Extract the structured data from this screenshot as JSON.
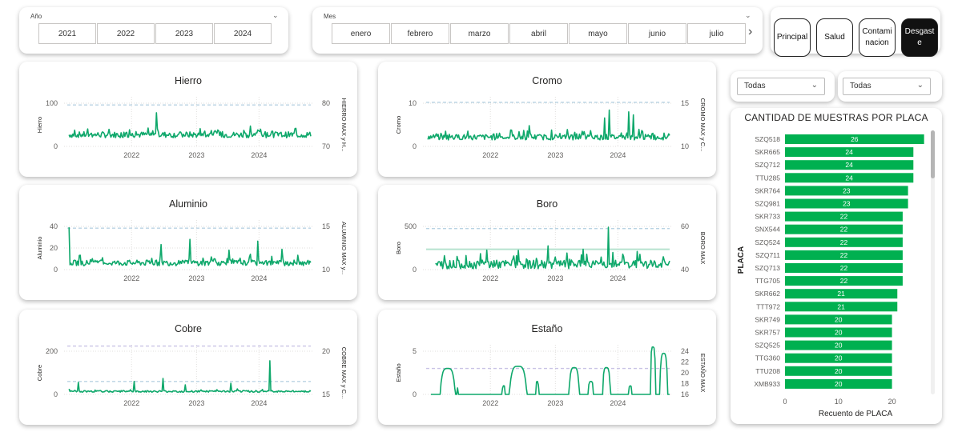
{
  "year_slicer": {
    "title": "Año",
    "items": [
      "2021",
      "2022",
      "2023",
      "2024"
    ]
  },
  "month_slicer": {
    "title": "Mes",
    "items": [
      "enero",
      "febrero",
      "marzo",
      "abril",
      "mayo",
      "junio",
      "julio"
    ]
  },
  "nav": {
    "buttons": [
      "Principal",
      "Salud",
      "Contami nacion",
      "Desgast e"
    ],
    "active": 3
  },
  "filters": {
    "left": "Todas",
    "right": "Todas"
  },
  "colors": {
    "line": "#0fa86b",
    "ref_dash": "#b9d3e3",
    "ref_dash_purple": "#c9c3e6",
    "ref_solid": "#b6e2cf",
    "bar": "#00b050"
  },
  "charts": [
    {
      "title": "Hierro",
      "ylabel": "Hierro",
      "y2label": "HIERRO MAX y H...",
      "yticks": [
        "100",
        "0"
      ],
      "y2ticks": [
        "80",
        "70"
      ],
      "xticks": [
        "2022",
        "2023",
        "2024"
      ]
    },
    {
      "title": "Cromo",
      "ylabel": "Cromo",
      "y2label": "CROMO MAX y C...",
      "yticks": [
        "10",
        "0"
      ],
      "y2ticks": [
        "15",
        "10"
      ],
      "xticks": [
        "2022",
        "2023",
        "2024"
      ]
    },
    {
      "title": "Aluminio",
      "ylabel": "Aluminio",
      "y2label": "ALUMINIO MAX y...",
      "yticks": [
        "40",
        "20",
        "0"
      ],
      "y2ticks": [
        "15",
        "10"
      ],
      "xticks": [
        "2022",
        "2023",
        "2024"
      ]
    },
    {
      "title": "Boro",
      "ylabel": "Boro",
      "y2label": "BORO MAX",
      "yticks": [
        "500",
        "0"
      ],
      "y2ticks": [
        "60",
        "40"
      ],
      "xticks": [
        "2022",
        "2023",
        "2024"
      ]
    },
    {
      "title": "Cobre",
      "ylabel": "Cobre",
      "y2label": "COBRE MAX y C...",
      "yticks": [
        "200",
        "0"
      ],
      "y2ticks": [
        "20",
        "15"
      ],
      "xticks": [
        "2022",
        "2023",
        "2024"
      ]
    },
    {
      "title": "Estaño",
      "ylabel": "Estaño",
      "y2label": "ESTAÑO MAX",
      "yticks": [
        "5",
        "0"
      ],
      "y2ticks": [
        "24",
        "22",
        "20",
        "18",
        "16"
      ],
      "xticks": [
        "2022",
        "2023",
        "2024"
      ]
    }
  ],
  "chart_data": [
    {
      "type": "bar",
      "title": "CANTIDAD DE MUESTRAS POR PLACA",
      "xlabel": "Recuento de PLACA",
      "ylabel": "PLACA",
      "categories": [
        "SZQ518",
        "SKR665",
        "SZQ712",
        "TTU285",
        "SKR764",
        "SZQ981",
        "SKR733",
        "SNX544",
        "SZQ524",
        "SZQ711",
        "SZQ713",
        "TTG705",
        "SKR662",
        "TTT972",
        "SKR749",
        "SKR757",
        "SZQ525",
        "TTG360",
        "TTU208",
        "XMB933"
      ],
      "values": [
        26,
        24,
        24,
        24,
        23,
        23,
        22,
        22,
        22,
        22,
        22,
        22,
        21,
        21,
        20,
        20,
        20,
        20,
        20,
        20
      ],
      "xticks": [
        "0",
        "10",
        "20"
      ],
      "xlim": [
        0,
        28
      ]
    }
  ]
}
